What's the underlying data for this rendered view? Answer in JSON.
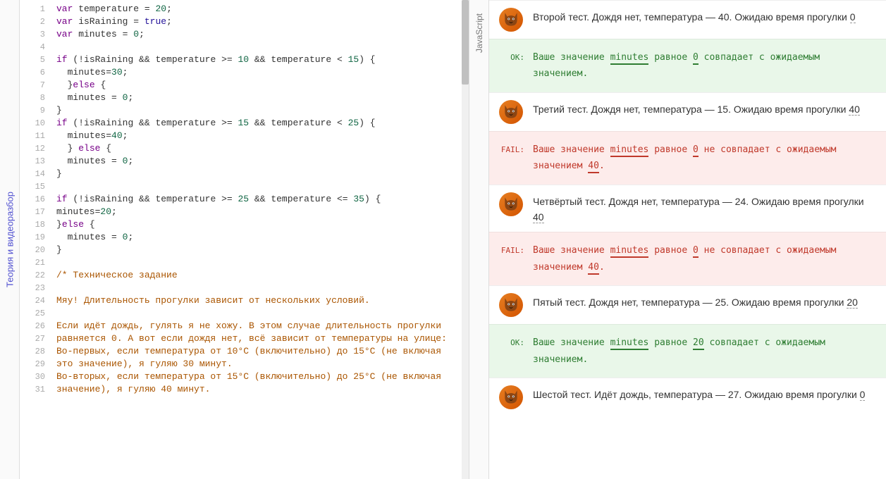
{
  "leftTab": "Теория и видеоразбор",
  "midTab": "JavaScript",
  "code": {
    "lines": [
      {
        "n": 1,
        "type": "code",
        "html": "<span class='tok-kw'>var</span> temperature <span class='tok-op'>=</span> <span class='tok-num'>20</span>;"
      },
      {
        "n": 2,
        "type": "code",
        "html": "<span class='tok-kw'>var</span> isRaining <span class='tok-op'>=</span> <span class='tok-bool'>true</span>;"
      },
      {
        "n": 3,
        "type": "code",
        "html": "<span class='tok-kw'>var</span> minutes <span class='tok-op'>=</span> <span class='tok-num'>0</span>;"
      },
      {
        "n": 4,
        "type": "code",
        "html": ""
      },
      {
        "n": 5,
        "type": "code",
        "html": "<span class='tok-kw'>if</span> (<span class='tok-op'>!</span>isRaining <span class='tok-op'>&&</span> temperature <span class='tok-op'>&gt;=</span> <span class='tok-num'>10</span> <span class='tok-op'>&&</span> temperature <span class='tok-op'>&lt;</span> <span class='tok-num'>15</span>) {"
      },
      {
        "n": 6,
        "type": "code",
        "html": "  minutes<span class='tok-op'>=</span><span class='tok-num'>30</span>;"
      },
      {
        "n": 7,
        "type": "code",
        "html": "  }<span class='tok-kw'>else</span> {"
      },
      {
        "n": 8,
        "type": "code",
        "html": "  minutes <span class='tok-op'>=</span> <span class='tok-num'>0</span>;"
      },
      {
        "n": 9,
        "type": "code",
        "html": "}"
      },
      {
        "n": 10,
        "type": "code",
        "html": "<span class='tok-kw'>if</span> (<span class='tok-op'>!</span>isRaining <span class='tok-op'>&&</span> temperature <span class='tok-op'>&gt;=</span> <span class='tok-num'>15</span> <span class='tok-op'>&&</span> temperature <span class='tok-op'>&lt;</span> <span class='tok-num'>25</span>) {"
      },
      {
        "n": 11,
        "type": "code",
        "html": "  minutes<span class='tok-op'>=</span><span class='tok-num'>40</span>;"
      },
      {
        "n": 12,
        "type": "code",
        "html": "  } <span class='tok-kw'>else</span> {"
      },
      {
        "n": 13,
        "type": "code",
        "html": "  minutes <span class='tok-op'>=</span> <span class='tok-num'>0</span>;"
      },
      {
        "n": 14,
        "type": "code",
        "html": "}"
      },
      {
        "n": 15,
        "type": "code",
        "html": ""
      },
      {
        "n": 16,
        "type": "code",
        "html": "<span class='tok-kw'>if</span> (<span class='tok-op'>!</span>isRaining <span class='tok-op'>&&</span> temperature <span class='tok-op'>&gt;=</span> <span class='tok-num'>25</span> <span class='tok-op'>&&</span> temperature <span class='tok-op'>&lt;=</span> <span class='tok-num'>35</span>) {"
      },
      {
        "n": 17,
        "type": "code",
        "html": "minutes<span class='tok-op'>=</span><span class='tok-num'>20</span>;"
      },
      {
        "n": 18,
        "type": "code",
        "html": "}<span class='tok-kw'>else</span> {"
      },
      {
        "n": 19,
        "type": "code",
        "html": "  minutes <span class='tok-op'>=</span> <span class='tok-num'>0</span>;"
      },
      {
        "n": 20,
        "type": "code",
        "html": "}"
      },
      {
        "n": 21,
        "type": "code",
        "html": ""
      },
      {
        "n": 22,
        "type": "comment",
        "html": "<span class='tok-comment'>/* Техническое задание</span>"
      },
      {
        "n": 23,
        "type": "comment",
        "html": ""
      },
      {
        "n": 24,
        "type": "comment",
        "html": "<span class='tok-comment'>Мяу! Длительность прогулки зависит от нескольких условий.</span>"
      },
      {
        "n": 25,
        "type": "comment",
        "html": ""
      },
      {
        "n": 26,
        "type": "comment",
        "html": "<span class='tok-comment'>Если идёт дождь, гулять я не хожу. В этом случае длительность прогулки равняется 0. А вот если дождя нет, всё зависит от температуры на улице:</span>"
      },
      {
        "n": 27,
        "type": "comment",
        "html": ""
      },
      {
        "n": 28,
        "type": "comment",
        "html": "<span class='tok-comment'>Во-первых, если температура от 10°C (включительно) до 15°C (не включая это значение), я гуляю 30 минут.</span>"
      },
      {
        "n": 29,
        "type": "comment",
        "html": ""
      },
      {
        "n": 30,
        "type": "comment",
        "html": "<span class='tok-comment'>Во-вторых, если температура от 15°C (включительно) до 25°C (не включая значение), я гуляю 40 минут.</span>"
      },
      {
        "n": 31,
        "type": "comment",
        "html": ""
      }
    ]
  },
  "results": [
    {
      "kind": "test",
      "text": "Второй тест. Дождя нет, температура — 40. Ожидаю время прогулки ",
      "val": "0"
    },
    {
      "kind": "ok",
      "label": "OK:",
      "msg": "Ваше значение <span class='ul-g'>minutes</span> равное <span class='ul-g'>0</span> совпадает с ожидаемым значением."
    },
    {
      "kind": "test",
      "text": "Третий тест. Дождя нет, температура — 15. Ожидаю время прогулки ",
      "val": "40"
    },
    {
      "kind": "fail",
      "label": "FAIL:",
      "msg": "Ваше значение <span class='ul-r'>minutes</span> равное <span class='ul-r'>0</span> не совпадает с ожидаемым значением <span class='ul-r'>40</span>."
    },
    {
      "kind": "test",
      "text": "Четвёртый тест. Дождя нет, температура — 24. Ожидаю время прогулки ",
      "val": "40"
    },
    {
      "kind": "fail",
      "label": "FAIL:",
      "msg": "Ваше значение <span class='ul-r'>minutes</span> равное <span class='ul-r'>0</span> не совпадает с ожидаемым значением <span class='ul-r'>40</span>."
    },
    {
      "kind": "test",
      "text": "Пятый тест. Дождя нет, температура — 25. Ожидаю время прогулки ",
      "val": "20"
    },
    {
      "kind": "ok",
      "label": "OK:",
      "msg": "Ваше значение <span class='ul-g'>minutes</span> равное <span class='ul-g'>20</span> совпадает с ожидаемым значением."
    },
    {
      "kind": "test",
      "text": "Шестой тест. Идёт дождь, температура — 27. Ожидаю время прогулки ",
      "val": "0"
    }
  ]
}
